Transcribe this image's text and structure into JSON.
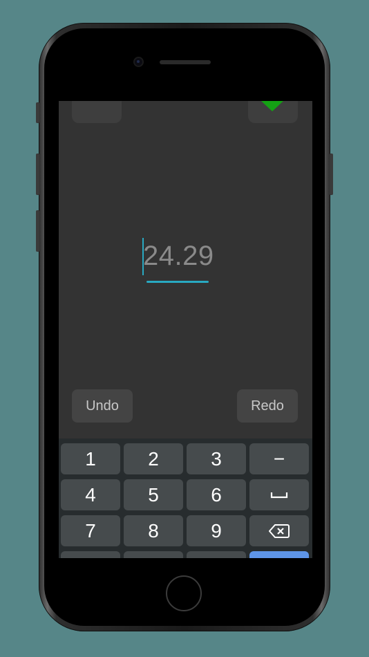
{
  "editor": {
    "value": "24.29",
    "undo_label": "Undo",
    "redo_label": "Redo"
  },
  "keyboard": {
    "row1": [
      "1",
      "2",
      "3",
      "−"
    ],
    "row2": [
      "4",
      "5",
      "6",
      "space-icon"
    ],
    "row3": [
      "7",
      "8",
      "9",
      "backspace-icon"
    ]
  },
  "colors": {
    "background": "#568688",
    "screen": "#333333",
    "accent": "#29a9c2",
    "confirm_green": "#14a214",
    "keyboard_bg": "#272c2e",
    "key_bg": "#464b4d",
    "key_blue": "#5e95e8"
  }
}
